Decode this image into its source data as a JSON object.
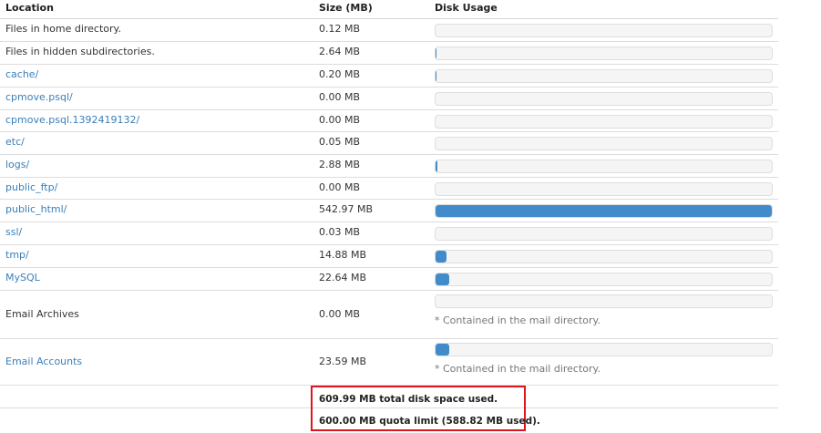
{
  "headers": {
    "location": "Location",
    "size": "Size (MB)",
    "usage": "Disk Usage"
  },
  "rows": [
    {
      "location": "Files in home directory.",
      "size": "0.12 MB",
      "link": false,
      "fill": 0.0002
    },
    {
      "location": "Files in hidden subdirectories.",
      "size": "2.64 MB",
      "link": false,
      "fill": 0.004
    },
    {
      "location": "cache/",
      "size": "0.20 MB",
      "link": true,
      "fill": 0.0003
    },
    {
      "location": "cpmove.psql/",
      "size": "0.00 MB",
      "link": true,
      "fill": 0
    },
    {
      "location": "cpmove.psql.1392419132/",
      "size": "0.00 MB",
      "link": true,
      "fill": 0
    },
    {
      "location": "etc/",
      "size": "0.05 MB",
      "link": true,
      "fill": 0.0001
    },
    {
      "location": "logs/",
      "size": "2.88 MB",
      "link": true,
      "fill": 0.005
    },
    {
      "location": "public_ftp/",
      "size": "0.00 MB",
      "link": true,
      "fill": 0
    },
    {
      "location": "public_html/",
      "size": "542.97 MB",
      "link": true,
      "fill": 1.0
    },
    {
      "location": "ssl/",
      "size": "0.03 MB",
      "link": true,
      "fill": 0.0001
    },
    {
      "location": "tmp/",
      "size": "14.88 MB",
      "link": true,
      "fill": 0.027
    },
    {
      "location": "MySQL",
      "size": "22.64 MB",
      "link": true,
      "fill": 0.04
    },
    {
      "location": "Email Archives",
      "size": "0.00 MB",
      "link": false,
      "fill": 0,
      "note": "* Contained in the mail directory."
    },
    {
      "location": "Email Accounts",
      "size": "23.59 MB",
      "link": true,
      "fill": 0.042,
      "note": "* Contained in the mail directory."
    }
  ],
  "totals": {
    "used": "609.99 MB total disk space used.",
    "quota": "600.00 MB quota limit (588.82 MB used)."
  },
  "colors": {
    "link": "#3a7fb8",
    "bar_fill": "#428bca",
    "bar_track": "#f5f5f5",
    "highlight_border": "#e0141e"
  }
}
